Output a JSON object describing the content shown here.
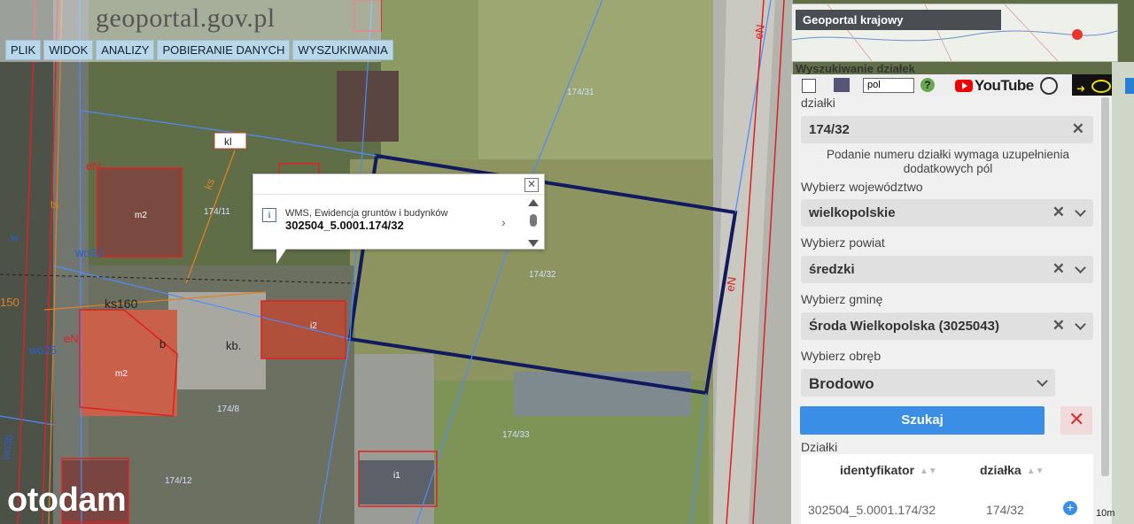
{
  "logo": {
    "text": "geoportal.gov.pl"
  },
  "menu": [
    "PLIK",
    "WIDOK",
    "ANALIZY",
    "POBIERANIE DANYCH",
    "WYSZUKIWANIA"
  ],
  "popup": {
    "source": "WMS, Ewidencja gruntów i budynków",
    "value": "302504_5.0001.174/32",
    "info_icon": "i"
  },
  "map_labels": {
    "kl": "kl",
    "ks": "ks",
    "ks160": "ks160",
    "eN1": "eN",
    "eN2": "eN",
    "eN3": "eN",
    "eN4": "eN",
    "wo32": "wo32",
    "wo25": "wo25",
    "m2a": "m2",
    "m2b": "m2",
    "i2": "i2",
    "i1": "i1",
    "kb": "kb.",
    "b": "b",
    "p17411": "174/11",
    "p17431": "174/31",
    "p17432": "174/32",
    "p17433": "174/33",
    "p1748": "174/8",
    "p17412": "174/12",
    "n150": "150",
    "ts": "ts",
    "w": "w",
    "wo30": "wo30"
  },
  "minimap": {
    "title": "Geoportal krajowy"
  },
  "panel": {
    "header": "Wyszukiwanie działek",
    "lang": "pol",
    "youtube": "YouTube",
    "dzialki_label": "działki",
    "dzialka_value": "174/32",
    "note": "Podanie numeru działki wymaga uzupełnienia dodatkowych pól",
    "woj_label": "Wybierz województwo",
    "woj_value": "wielkopolskie",
    "powiat_label": "Wybierz powiat",
    "powiat_value": "średzki",
    "gmina_label": "Wybierz gminę",
    "gmina_value": "Środa Wielkopolska (3025043)",
    "obreb_label": "Wybierz obręb",
    "obreb_value": "Brodowo",
    "search_button": "Szukaj",
    "results_label": "Działki",
    "table": {
      "headers": [
        "identyfikator",
        "działka"
      ],
      "rows": [
        [
          "302504_5.0001.174/32",
          "174/32"
        ]
      ]
    }
  },
  "scale": "10m",
  "watermark": "otodam"
}
